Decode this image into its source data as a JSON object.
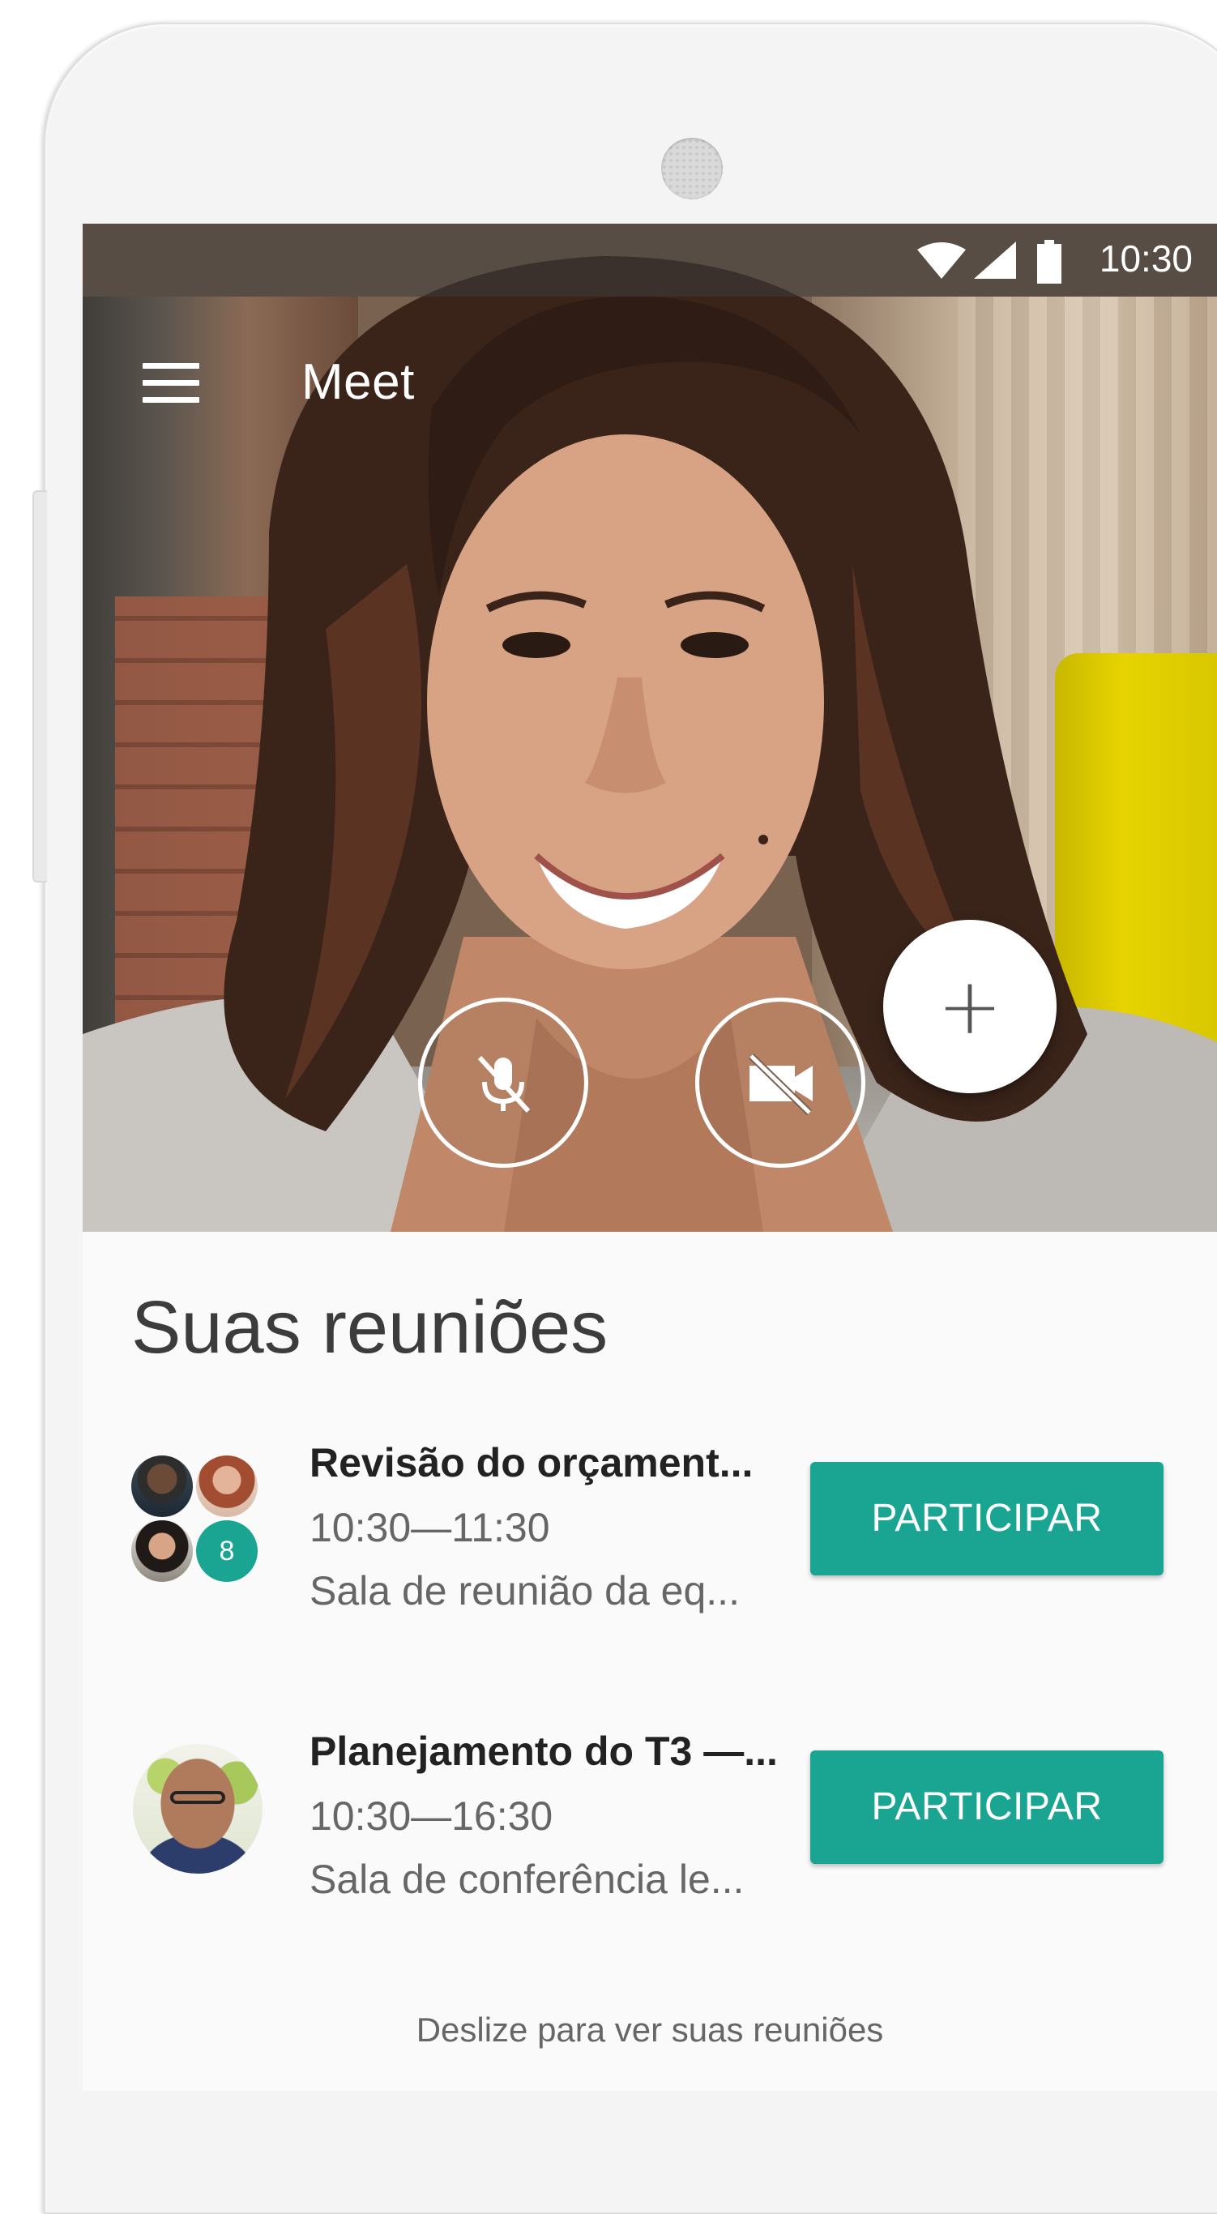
{
  "status_bar": {
    "time": "10:30"
  },
  "app_bar": {
    "title": "Meet",
    "menu_icon": "menu-icon"
  },
  "controls": {
    "mic_icon": "mic-off-icon",
    "camera_icon": "videocam-off-icon"
  },
  "fab": {
    "label": "+",
    "icon": "add-icon"
  },
  "meetings_section": {
    "title": "Suas reuniões"
  },
  "meetings": [
    {
      "title": "Revisão do orçament...",
      "time": "10:30—11:30",
      "room": "Sala de reunião da eq...",
      "join_label": "PARTICIPAR",
      "extra_participants": "8"
    },
    {
      "title": "Planejamento do T3 —...",
      "time": "10:30—16:30",
      "room": "Sala de conferência le...",
      "join_label": "PARTICIPAR"
    }
  ],
  "footer": {
    "hint": "Deslize para ver suas reuniões"
  },
  "colors": {
    "accent": "#1aa592",
    "status_bar": "#3c3c3c",
    "background": "#fafafa"
  }
}
